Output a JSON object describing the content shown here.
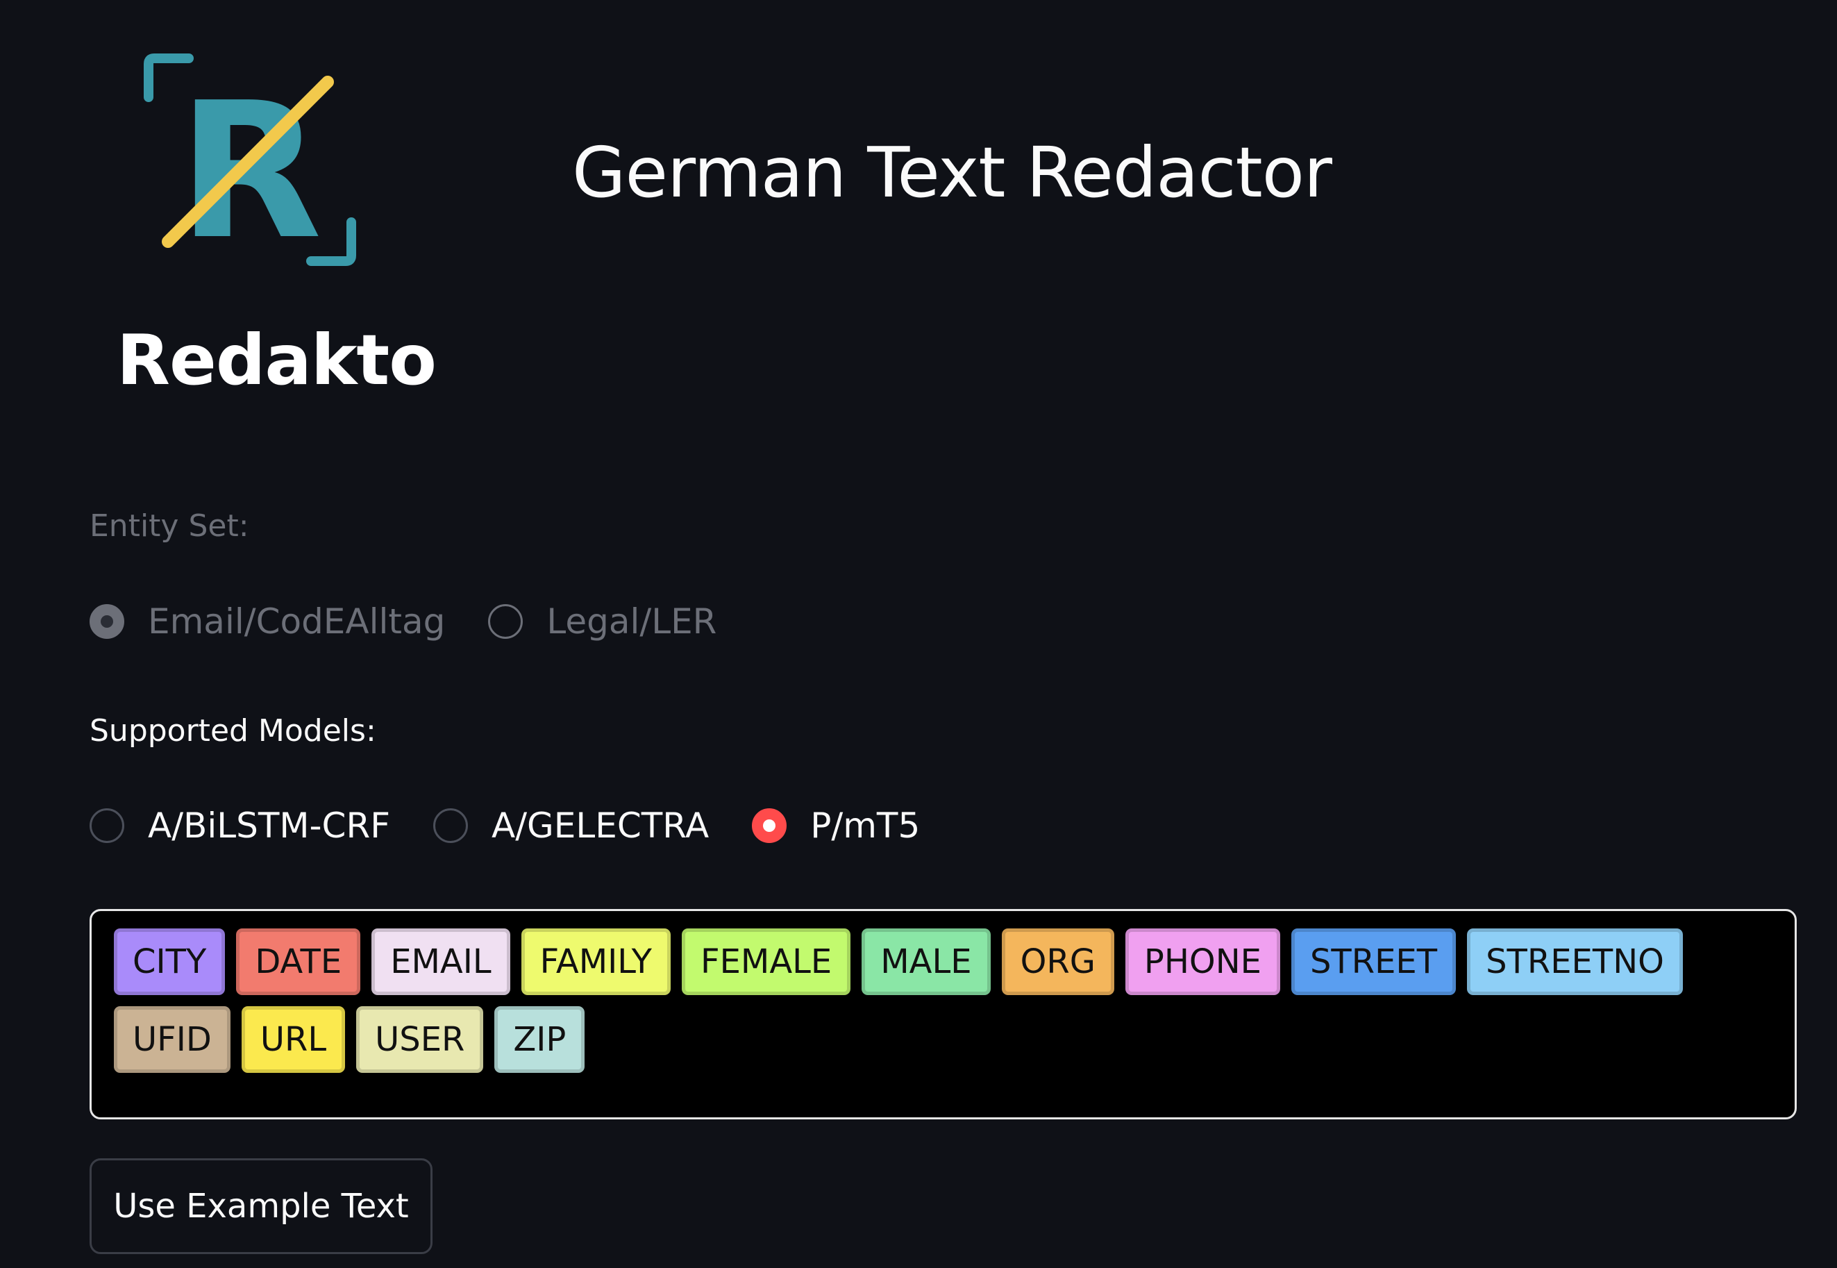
{
  "brand": {
    "name": "Redakto",
    "logo_icon": "redacted-r-icon",
    "logo_letter_color": "#3a9aaa",
    "logo_slash_color": "#f2c94c"
  },
  "app": {
    "title": "German Text Redactor"
  },
  "entity_set": {
    "label": "Entity Set:",
    "options": [
      {
        "label": "Email/CodEAlltag",
        "checked": true
      },
      {
        "label": "Legal/LER",
        "checked": false
      }
    ]
  },
  "models": {
    "label": "Supported Models:",
    "options": [
      {
        "label": "A/BiLSTM-CRF",
        "checked": false
      },
      {
        "label": "A/GELECTRA",
        "checked": false
      },
      {
        "label": "P/mT5",
        "checked": true
      }
    ],
    "accent_color": "#ff4b4b"
  },
  "entities": [
    {
      "label": "CITY",
      "color": "#a98bfa"
    },
    {
      "label": "DATE",
      "color": "#f27b6e"
    },
    {
      "label": "EMAIL",
      "color": "#f0e0f2"
    },
    {
      "label": "FAMILY",
      "color": "#eefa6e"
    },
    {
      "label": "FEMALE",
      "color": "#c2fa6e"
    },
    {
      "label": "MALE",
      "color": "#8ae6a6"
    },
    {
      "label": "ORG",
      "color": "#f4b65c"
    },
    {
      "label": "PHONE",
      "color": "#f0a0f0"
    },
    {
      "label": "STREET",
      "color": "#5a9ef0"
    },
    {
      "label": "STREETNO",
      "color": "#8ecff6"
    },
    {
      "label": "UFID",
      "color": "#cbb394"
    },
    {
      "label": "URL",
      "color": "#fbe94e"
    },
    {
      "label": "USER",
      "color": "#e8e8b0"
    },
    {
      "label": "ZIP",
      "color": "#b8e0dc"
    }
  ],
  "actions": {
    "example_label": "Use Example Text"
  }
}
